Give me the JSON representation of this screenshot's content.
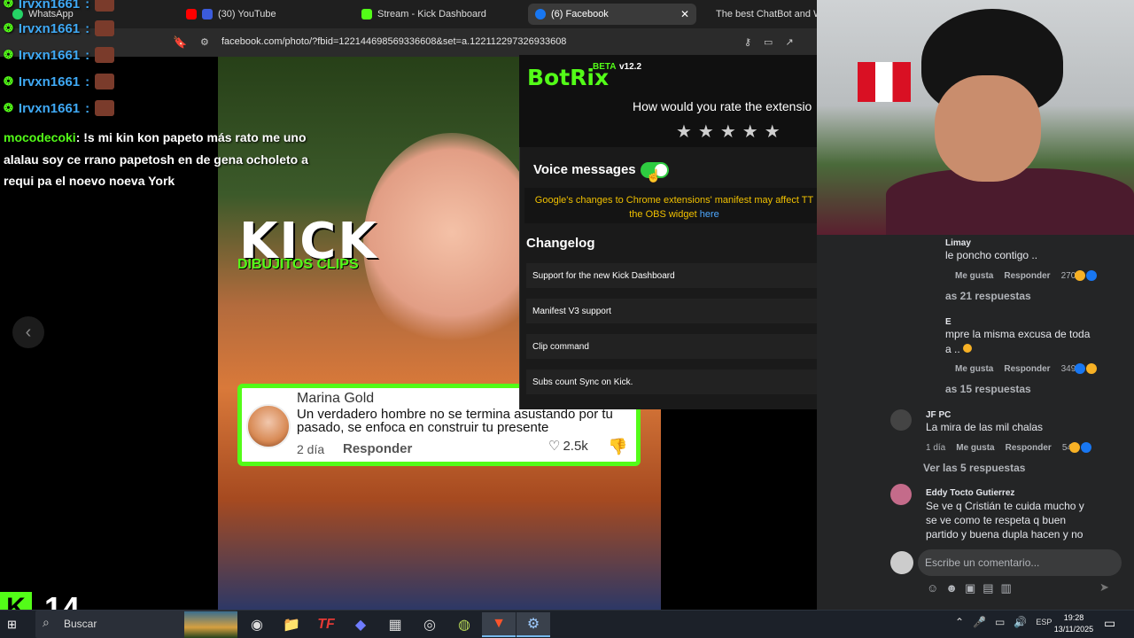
{
  "browser": {
    "tabs": [
      {
        "label": "WhatsApp",
        "icon": "whatsapp-icon",
        "color": "#25d366"
      },
      {
        "label": "(30) YouTube",
        "icon": "youtube-icon",
        "color": "#ff0000"
      },
      {
        "label": "Stream - Kick Dashboard",
        "icon": "kick-icon",
        "color": "#53fc18"
      },
      {
        "label": "(6) Facebook",
        "icon": "facebook-icon",
        "color": "#1877f2"
      },
      {
        "label": "The best ChatBot and W",
        "icon": "botrix-icon",
        "color": "#ffffff"
      }
    ],
    "url": "facebook.com/photo/?fbid=122144698569336608&set=a.122112297326933608"
  },
  "chat_overlay": {
    "repeat_user": "Irvxn1661",
    "separator": ":",
    "message_user": "mocodecoki",
    "message_text": ": !s mi kin kon papeto más rato me uno alalau soy ce rrano papetosh en de gena ocholeto a requi pa el noevo noeva York"
  },
  "video": {
    "brand_title": "KICK",
    "brand_subtitle": "DIBUJITOS CLIPS",
    "comment": {
      "author": "Marina Gold",
      "text": "Un verdadero hombre no se termina asustando por tu pasado, se enfoca en construir tu presente",
      "age": "2 día",
      "reply_label": "Responder",
      "likes": "2.5k"
    }
  },
  "botrix": {
    "logo": "BotRix",
    "beta": "BETA",
    "version": "v12.2",
    "rate_prompt": "How would you rate the extensio",
    "stars": "★★★★★",
    "voice_label": "Voice messages",
    "voice_enabled": true,
    "notice_text": "Google's changes to Chrome extensions' manifest may affect TT",
    "notice_text2": "the OBS widget",
    "notice_link": "here",
    "changelog_title": "Changelog",
    "changelog": [
      "Support for the new Kick Dashboard",
      "Manifest V3 support",
      "Clip command",
      "Subs count Sync on Kick."
    ]
  },
  "facebook": {
    "comments": [
      {
        "name": "Limay",
        "text": "le poncho contigo ..",
        "like_label": "Me gusta",
        "reply_label": "Responder",
        "count": "270",
        "replies": "as 21 respuestas"
      },
      {
        "name": "E",
        "text": "mpre la misma excusa de toda",
        "text2": "a ..",
        "like_label": "Me gusta",
        "reply_label": "Responder",
        "count": "349",
        "replies": "as 15 respuestas"
      },
      {
        "name": "JF PC",
        "text": "La mira de las mil chalas",
        "age": "1 día",
        "like_label": "Me gusta",
        "reply_label": "Responder",
        "count": "54",
        "replies": "Ver las 5 respuestas"
      },
      {
        "name": "Eddy Tocto Gutierrez",
        "text": "Se ve q Cristián te cuida mucho y se ve como te respeta q buen partido y buena dupla hacen y no"
      }
    ],
    "input_placeholder": "Escribe un comentario...",
    "send_icon": "send-icon"
  },
  "kick_badge": {
    "letter": "K",
    "count": "14"
  },
  "taskbar": {
    "search_label": "Buscar",
    "tray_lang": "ESP",
    "time": "19:28",
    "date": "13/11/2025"
  }
}
